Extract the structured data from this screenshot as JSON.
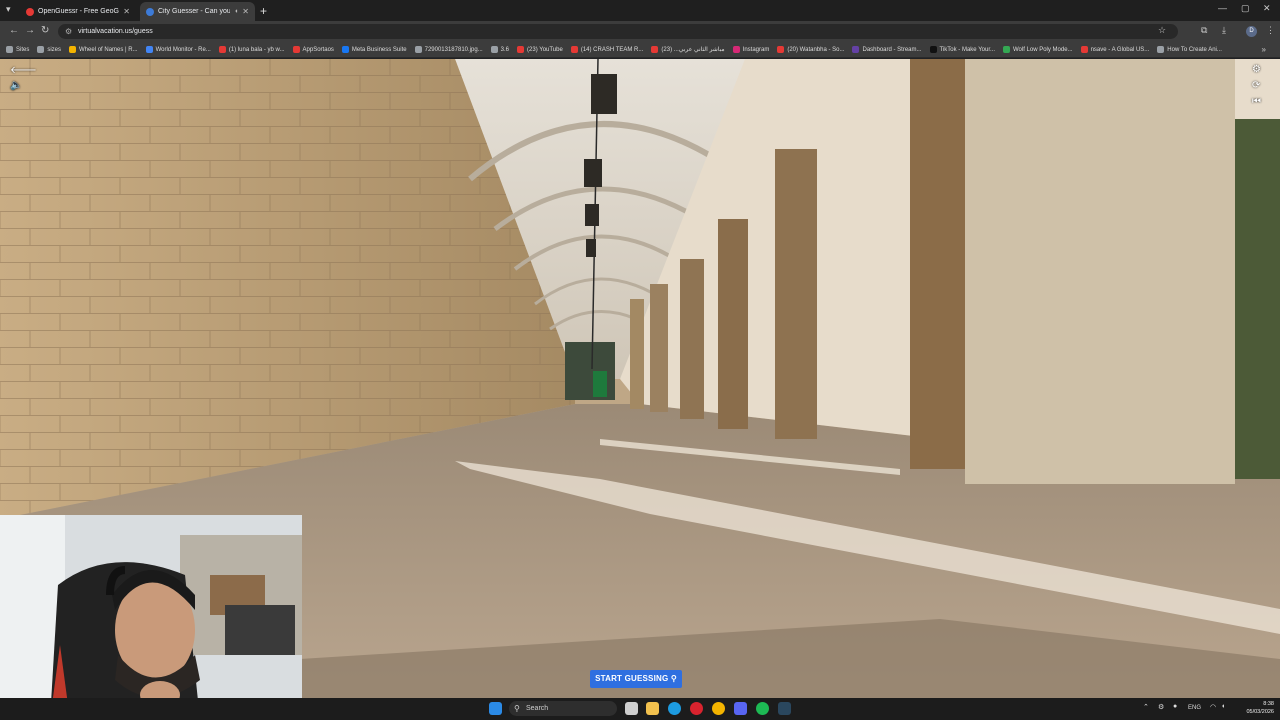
{
  "browser": {
    "tabs": [
      {
        "title": "OpenGuessr - Free GeoGuessr",
        "active": false,
        "favicon_color": "#e53935"
      },
      {
        "title": "City Guesser - Can you gu",
        "active": true,
        "favicon_color": "#3d7bd8"
      }
    ],
    "url": "virtualvacation.us/guess",
    "profile_initial": "D",
    "bookmarks": [
      {
        "label": "Sites",
        "icon_color": "#9aa0a6"
      },
      {
        "label": "sizes",
        "icon_color": "#9aa0a6"
      },
      {
        "label": "Wheel of Names | R...",
        "icon_color": "#f4b400"
      },
      {
        "label": "World Monitor - Re...",
        "icon_color": "#4285f4"
      },
      {
        "label": "(1) luna bala - yb w...",
        "icon_color": "#e53935"
      },
      {
        "label": "AppSortaos",
        "icon_color": "#e53935"
      },
      {
        "label": "Meta Business Suite",
        "icon_color": "#1877f2"
      },
      {
        "label": "7290013187810.jpg...",
        "icon_color": "#9aa0a6"
      },
      {
        "label": "3.6",
        "icon_color": "#9aa0a6"
      },
      {
        "label": "(23) YouTube",
        "icon_color": "#e53935"
      },
      {
        "label": "(14) CRASH TEAM R...",
        "icon_color": "#e53935"
      },
      {
        "label": "مباشر الثاني عربي... (23)",
        "icon_color": "#e53935"
      },
      {
        "label": "Instagram",
        "icon_color": "#d62976"
      },
      {
        "label": "(20) Watanbha - So...",
        "icon_color": "#e53935"
      },
      {
        "label": "Dashboard - Stream...",
        "icon_color": "#6441a5"
      },
      {
        "label": "TikTok - Make Your...",
        "icon_color": "#111111"
      },
      {
        "label": "Wolf Low Poly Mode...",
        "icon_color": "#34a853"
      },
      {
        "label": "nsave - A Global US...",
        "icon_color": "#e53935"
      },
      {
        "label": "How To Create Ani...",
        "icon_color": "#9aa0a6"
      }
    ]
  },
  "game": {
    "start_button": "START GUESSING",
    "controls_left": [
      "back-arrow-icon",
      "volume-icon"
    ],
    "controls_right": [
      "settings-icon",
      "refresh-icon",
      "skip-back-icon"
    ]
  },
  "taskbar": {
    "search_placeholder": "Search",
    "lang": "ENG",
    "time": "8:38",
    "date": "05/03/2026"
  }
}
